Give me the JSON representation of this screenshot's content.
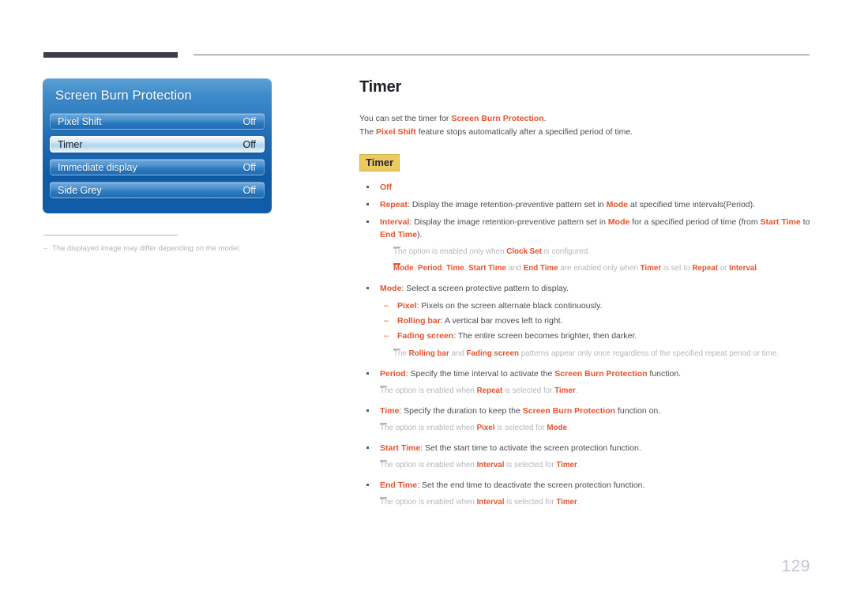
{
  "page": {
    "number": "129",
    "title": "Timer"
  },
  "osd": {
    "title": "Screen Burn Protection",
    "rows": [
      {
        "label": "Pixel Shift",
        "value": "Off",
        "selected": false
      },
      {
        "label": "Timer",
        "value": "Off",
        "selected": true
      },
      {
        "label": "Immediate display",
        "value": "Off",
        "selected": false
      },
      {
        "label": "Side Grey",
        "value": "Off",
        "selected": false
      }
    ]
  },
  "left_note": {
    "dash": "–",
    "text": "The displayed image may differ depending on the model."
  },
  "intro": {
    "line1_a": "You can set the timer for ",
    "line1_b": "Screen Burn Protection",
    "line1_c": ".",
    "line2_a": "The ",
    "line2_b": "Pixel Shift",
    "line2_c": " feature stops automatically after a specified period of time."
  },
  "badge": {
    "label": "Timer"
  },
  "items": {
    "off": "Off",
    "repeat_term": "Repeat",
    "repeat_t1": ": Display the image retention-preventive pattern set in ",
    "repeat_em1": "Mode",
    "repeat_t2": " at specified time intervals(Period).",
    "interval_term": "Interval",
    "interval_t1": ": Display the image retention-preventive pattern set in ",
    "interval_em1": "Mode",
    "interval_t2": " for a specified period of time (from ",
    "interval_em2": "Start Time",
    "interval_t3": " to ",
    "interval_em3": "End Time",
    "interval_t4": ").",
    "note_clock_a": "The option is enabled only when ",
    "note_clock_em": "Clock Set",
    "note_clock_b": " is configured.",
    "note_modes_em1": "Mode",
    "note_modes_s1": ", ",
    "note_modes_em2": "Period",
    "note_modes_s2": ", ",
    "note_modes_em3": "Time",
    "note_modes_s3": ", ",
    "note_modes_em4": "Start Time",
    "note_modes_s4": " and ",
    "note_modes_em5": "End Time",
    "note_modes_s5": " are enabled only when ",
    "note_modes_em6": "Timer",
    "note_modes_s6": " is set to ",
    "note_modes_em7": "Repeat",
    "note_modes_s7": " or ",
    "note_modes_em8": "Interval",
    "note_modes_s8": ".",
    "mode_term": "Mode",
    "mode_t1": ": Select a screen protective pattern to display.",
    "pixel_term": "Pixel",
    "pixel_t1": ": Pixels on the screen alternate black continuously.",
    "rolling_term": "Rolling bar",
    "rolling_t1": ": A vertical bar moves left to right.",
    "fading_term": "Fading screen",
    "fading_t1": ": The entire screen becomes brighter, then darker.",
    "note_patterns_a": "The ",
    "note_patterns_em1": "Rolling bar",
    "note_patterns_b": " and ",
    "note_patterns_em2": "Fading screen",
    "note_patterns_c": " patterns appear only once regardless of the specified repeat period or time.",
    "period_term": "Period",
    "period_t1": ": Specify the time interval to activate the ",
    "period_em1": "Screen Burn Protection",
    "period_t2": " function.",
    "note_period_a": "The option is enabled when ",
    "note_period_em1": "Repeat",
    "note_period_b": " is selected for ",
    "note_period_em2": "Timer",
    "note_period_c": ".",
    "time_term": "Time",
    "time_t1": ": Specify the duration to keep the ",
    "time_em1": "Screen Burn Protection",
    "time_t2": " function on.",
    "note_time_a": "The option is enabled when ",
    "note_time_em1": "Pixel",
    "note_time_b": " is selected for ",
    "note_time_em2": "Mode",
    "note_time_c": ".",
    "start_term": "Start Time",
    "start_t1": ": Set the start time to activate the screen protection function.",
    "note_start_a": "The option is enabled when ",
    "note_start_em1": "Interval",
    "note_start_b": " is selected for ",
    "note_start_em2": "Timer",
    "note_start_c": ".",
    "end_term": "End Time",
    "end_t1": ": Set the end time to deactivate the screen protection function.",
    "note_end_a": "The option is enabled when ",
    "note_end_em1": "Interval",
    "note_end_b": " is selected for ",
    "note_end_em2": "Timer",
    "note_end_c": "."
  },
  "colors": {
    "accent_orange": "#e8522b",
    "badge_yellow": "#e9cb62",
    "panel_blue": "#1f6cb5",
    "note_grey": "#b6b6be"
  }
}
